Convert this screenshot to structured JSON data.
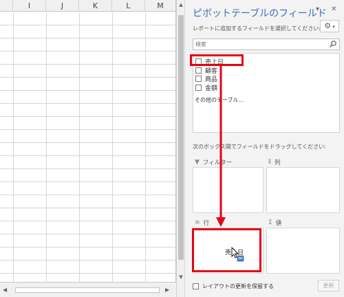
{
  "sheet": {
    "columns": [
      "I",
      "J",
      "K",
      "L",
      "M"
    ]
  },
  "pane": {
    "title": "ピボットテーブルのフィールド",
    "subtitle": "レポートに追加するフィールドを選択してください:",
    "search_placeholder": "検索",
    "fields": [
      {
        "label": "売上日",
        "checked": false
      },
      {
        "label": "顧客",
        "checked": false
      },
      {
        "label": "商品",
        "checked": false
      },
      {
        "label": "金額",
        "checked": false
      }
    ],
    "other_tables": "その他のテーブル...",
    "drag_hint": "次のボックス間でフィールドをドラッグしてください:",
    "areas": {
      "filter": {
        "label": "フィルター",
        "icon": "filter-icon"
      },
      "columns": {
        "label": "列",
        "icon": "columns-icon"
      },
      "rows": {
        "label": "行",
        "icon": "rows-icon",
        "item": "売上日"
      },
      "values": {
        "label": "値",
        "icon": "sigma-icon"
      }
    },
    "defer_label": "レイアウトの更新を保留する",
    "update_label": "更新"
  },
  "colors": {
    "accent_title": "#3c6fb4",
    "annotation_red": "#e60012"
  }
}
